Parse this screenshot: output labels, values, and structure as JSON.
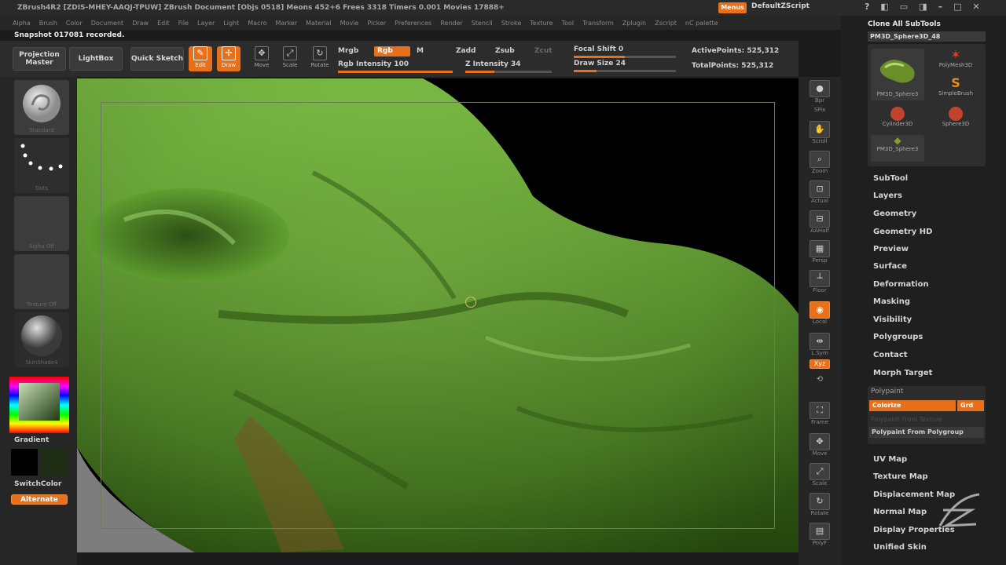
{
  "titlebar": {
    "title": "ZBrush4R2  [ZDIS-MHEY-AAQJ-TPUW]    ZBrush Document     [Objs 0518]  Meons 452+6  Frees 3318  Timers 0.001  Movies 17888+",
    "menus_label": "Menus",
    "script_label": "DefaultZScript"
  },
  "menubar": [
    "Alpha",
    "Brush",
    "Color",
    "Document",
    "Draw",
    "Edit",
    "File",
    "Layer",
    "Light",
    "Macro",
    "Marker",
    "Material",
    "Movie",
    "Picker",
    "Preferences",
    "Render",
    "Stencil",
    "Stroke",
    "Texture",
    "Tool",
    "Transform",
    "Zplugin",
    "Zscript",
    "nC palette"
  ],
  "status": "Snapshot 017081 recorded.",
  "shelf": {
    "projection_master": "Projection Master",
    "lightbox": "LightBox",
    "quick_sketch": "Quick Sketch",
    "edit": "Edit",
    "draw": "Draw",
    "move": "Move",
    "scale": "Scale",
    "rotate": "Rotate",
    "mrgb": "Mrgb",
    "rgb": "Rgb",
    "m": "M",
    "rgb_intensity": "Rgb Intensity 100",
    "zadd": "Zadd",
    "zsub": "Zsub",
    "zcut": "Zcut",
    "z_intensity": "Z Intensity 34",
    "focal_shift": "Focal Shift 0",
    "draw_size": "Draw Size 24",
    "active_points": "ActivePoints: 525,312",
    "total_points": "TotalPoints: 525,312"
  },
  "leftbar": {
    "brush_label": "Standard",
    "stroke_label": "Dots",
    "alpha_label": "Alpha Off",
    "texture_label": "Texture Off",
    "material_label": "SkinShade4",
    "gradient": "Gradient",
    "switch_color": "SwitchColor",
    "alternate": "Alternate"
  },
  "righttools": [
    "Bpr",
    "SPix",
    "Scroll",
    "Zoom",
    "Actual",
    "AAHalf",
    "Persp",
    "Floor",
    "Local",
    "L.Sym",
    "Xyz",
    "Frame",
    "Move",
    "Scale",
    "Rotate",
    "PolyF"
  ],
  "rpanel": {
    "clone_label": "Clone  All SubTools",
    "current_tool": "PM3D_Sphere3D_48",
    "subtools": [
      "PM3D_Sphere3",
      "PolyMesh3D",
      "SimpleBrush",
      "Cylinder3D",
      "Sphere3D",
      "PM3D_Sphere3"
    ],
    "menu": [
      "SubTool",
      "Layers",
      "Geometry",
      "Geometry HD",
      "Preview",
      "Surface",
      "Deformation",
      "Masking",
      "Visibility",
      "Polygroups",
      "Contact",
      "Morph Target"
    ],
    "polypaint": {
      "title": "Polypaint",
      "colorize": "Colorize",
      "grd": "Grd",
      "from_texture": "Polypaint From Texture",
      "from_polygroup": "Polypaint From Polygroup"
    },
    "menu2": [
      "UV Map",
      "Texture Map",
      "Displacement Map",
      "Normal Map",
      "Display Properties",
      "Unified Skin"
    ]
  },
  "colors": {
    "accent": "#e8701a",
    "model_green": "#5fa32f"
  },
  "sliders": {
    "rgb_intensity": 1.0,
    "z_intensity": 0.34,
    "focal_shift": 0.5,
    "draw_size": 0.22
  }
}
